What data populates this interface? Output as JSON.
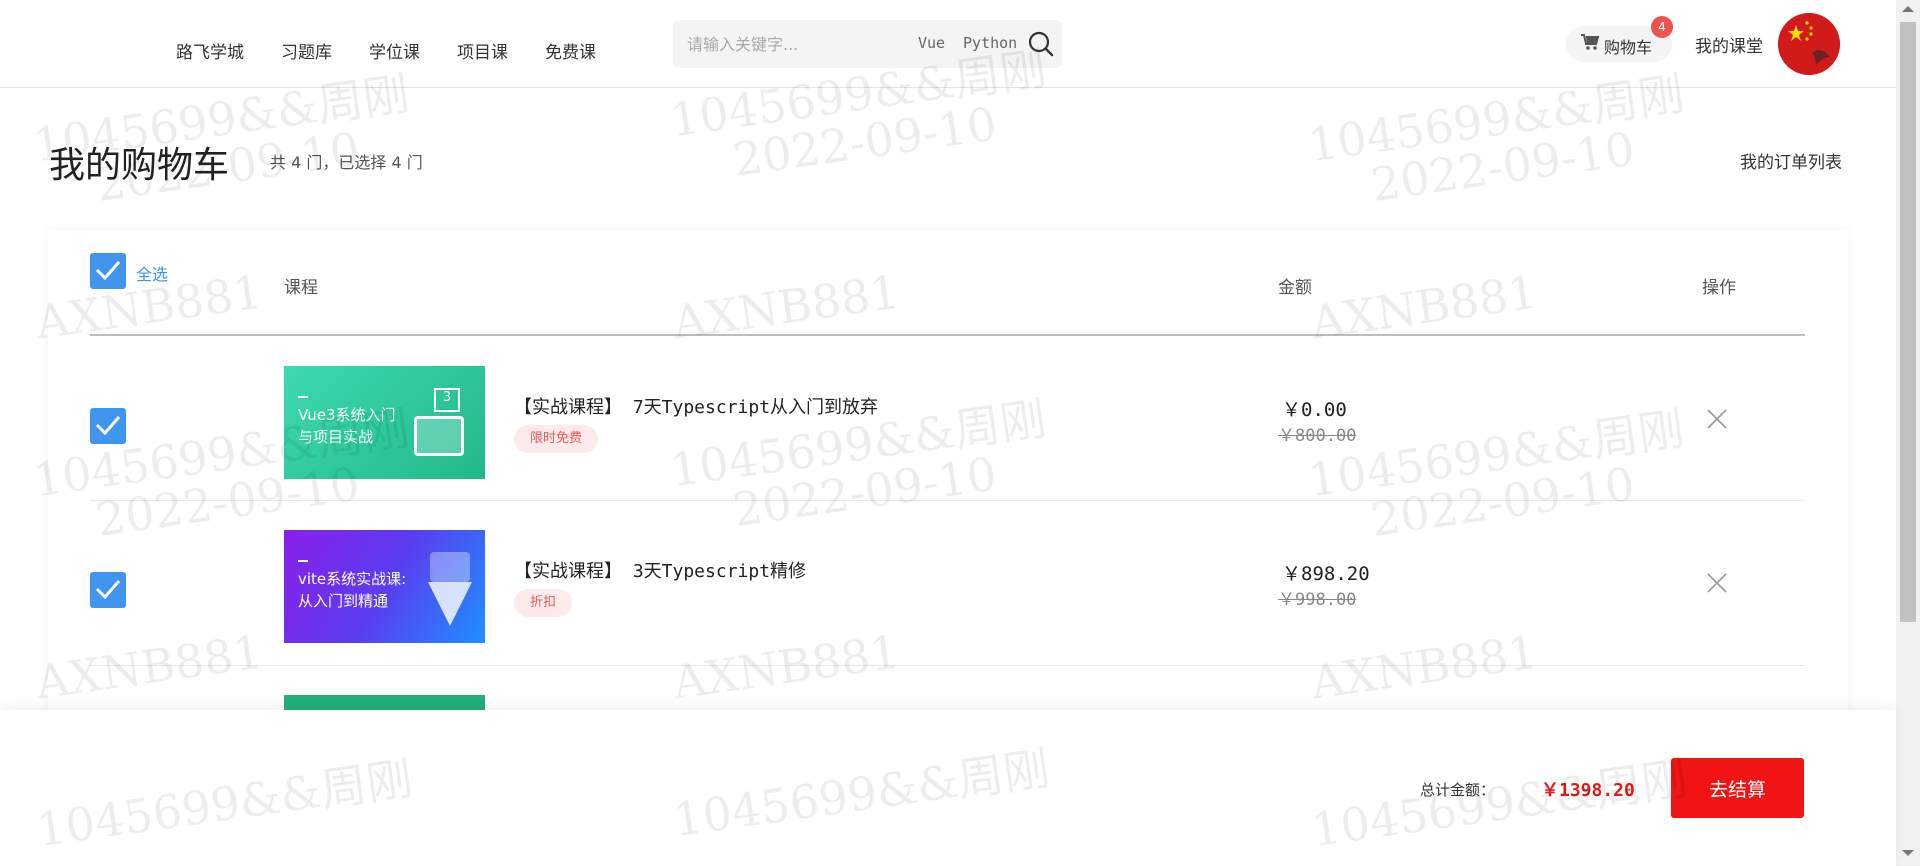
{
  "header": {
    "nav": [
      "路飞学城",
      "习题库",
      "学位课",
      "项目课",
      "免费课"
    ],
    "search": {
      "placeholder": "请输入关键字...",
      "hot": [
        "Vue",
        "Python"
      ]
    },
    "cart_label": "购物车",
    "cart_count": "4",
    "my_class": "我的课堂"
  },
  "page": {
    "title": "我的购物车",
    "summary": "共 4 门，已选择 4 门",
    "orders_link": "我的订单列表"
  },
  "table": {
    "select_all": "全选",
    "columns": {
      "course": "课程",
      "amount": "金额",
      "action": "操作"
    },
    "items": [
      {
        "thumb_text": "Vue3系统入门\n与项目实战",
        "thumb_color": "#2ecf9f",
        "name": "【实战课程】 7天Typescript从入门到放弃",
        "tag": "限时免费",
        "price": "￥0.00",
        "original_price": "￥800.00",
        "checked": true
      },
      {
        "thumb_text": "vite系统实战课:\n从入门到精通",
        "thumb_color": "#8a2be2",
        "name": "【实战课程】 3天Typescript精修",
        "tag": "折扣",
        "price": "￥898.20",
        "original_price": "￥998.00",
        "checked": true
      }
    ]
  },
  "footer": {
    "total_label": "总计金额：",
    "total": "￥1398.20",
    "checkout": "去结算"
  },
  "watermark": {
    "user": "1045699&&周刚",
    "date": "2022-09-10",
    "code": "AXNB881"
  },
  "colors": {
    "accent": "#4096ee",
    "checkout": "#f01414",
    "price": "#e01b1b"
  }
}
